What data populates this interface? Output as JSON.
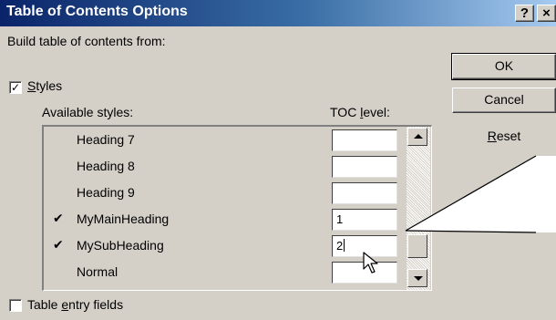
{
  "window": {
    "title": "Table of Contents Options",
    "help_button": "?",
    "close_button": "×"
  },
  "build_label": "Build table of contents from:",
  "styles_option": {
    "label": "Styles",
    "checked": true,
    "check_mark": "✓"
  },
  "columns": {
    "available_styles": "Available styles:",
    "toc_level": "TOC level:"
  },
  "styles": [
    {
      "name": "Heading 7",
      "checked": false,
      "check_mark": "",
      "level": ""
    },
    {
      "name": "Heading 8",
      "checked": false,
      "check_mark": "",
      "level": ""
    },
    {
      "name": "Heading 9",
      "checked": false,
      "check_mark": "",
      "level": ""
    },
    {
      "name": "MyMainHeading",
      "checked": true,
      "check_mark": "✔",
      "level": "1"
    },
    {
      "name": "MySubHeading",
      "checked": true,
      "check_mark": "✔",
      "level": "2"
    },
    {
      "name": "Normal",
      "checked": false,
      "check_mark": "",
      "level": ""
    }
  ],
  "table_entry_fields": {
    "label": "Table entry fields",
    "checked": false,
    "check_mark": ""
  },
  "buttons": {
    "ok": "OK",
    "cancel": "Cancel",
    "reset": "Reset"
  },
  "colors": {
    "dialog_face": "#d4d0c8",
    "title_gradient_start": "#0a246a",
    "title_gradient_end": "#a6caf0",
    "title_text": "#ffffff"
  },
  "icons": {
    "scroll_up": "triangle-up-icon",
    "scroll_down": "triangle-down-icon",
    "cursor": "mouse-pointer-icon"
  }
}
